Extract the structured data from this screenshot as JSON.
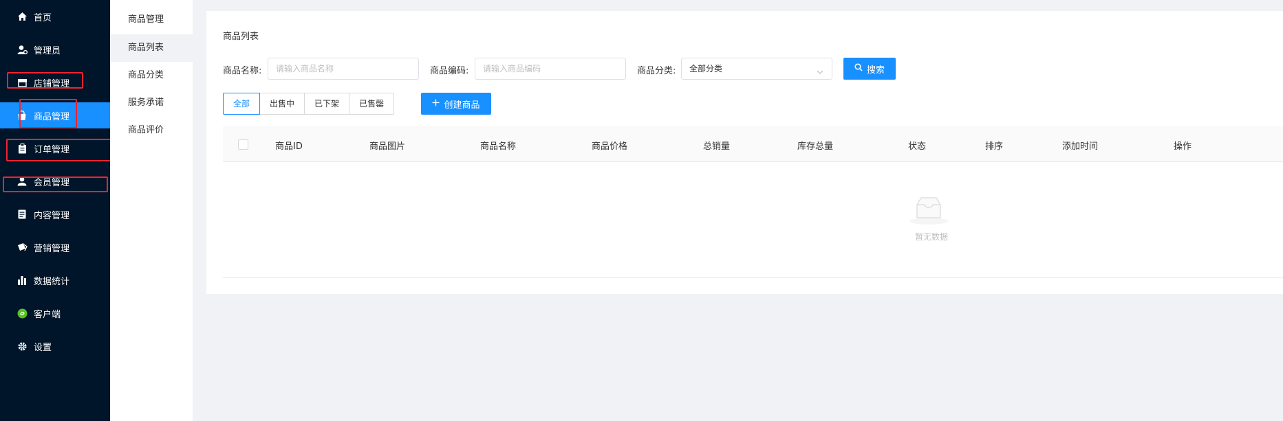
{
  "sidebar": {
    "items": [
      {
        "label": "首页",
        "icon": "home-icon"
      },
      {
        "label": "管理员",
        "icon": "admin-user-icon"
      },
      {
        "label": "店铺管理",
        "icon": "store-icon"
      },
      {
        "label": "商品管理",
        "icon": "shopping-bag-icon",
        "active": true
      },
      {
        "label": "订单管理",
        "icon": "clipboard-icon"
      },
      {
        "label": "会员管理",
        "icon": "user-icon"
      },
      {
        "label": "内容管理",
        "icon": "document-icon"
      },
      {
        "label": "营销管理",
        "icon": "marketing-icon"
      },
      {
        "label": "数据统计",
        "icon": "bar-chart-icon"
      },
      {
        "label": "客户端",
        "icon": "mini-program-icon"
      },
      {
        "label": "设置",
        "icon": "gear-icon"
      }
    ]
  },
  "subnav": {
    "items": [
      {
        "label": "商品管理"
      },
      {
        "label": "商品列表",
        "active": true
      },
      {
        "label": "商品分类"
      },
      {
        "label": "服务承诺"
      },
      {
        "label": "商品评价"
      }
    ]
  },
  "card": {
    "title": "商品列表",
    "filters": {
      "name_label": "商品名称:",
      "name_placeholder": "请输入商品名称",
      "code_label": "商品编码:",
      "code_placeholder": "请输入商品编码",
      "category_label": "商品分类:",
      "category_value": "全部分类",
      "search_button": "搜索"
    },
    "tabs": [
      "全部",
      "出售中",
      "已下架",
      "已售罄"
    ],
    "create_button": "创建商品",
    "table": {
      "columns": [
        "商品ID",
        "商品图片",
        "商品名称",
        "商品价格",
        "总销量",
        "库存总量",
        "状态",
        "排序",
        "添加时间",
        "操作"
      ]
    },
    "empty_text": "暂无数据"
  },
  "colors": {
    "sidebar_bg": "#001529",
    "accent": "#1890ff",
    "annotation": "#f5222d"
  }
}
